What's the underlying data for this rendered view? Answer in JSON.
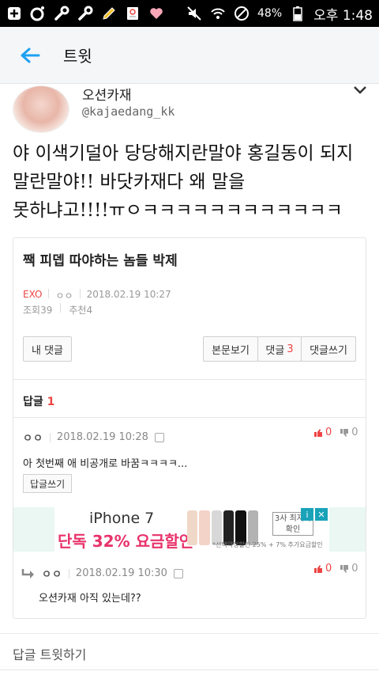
{
  "status_bar": {
    "battery": "48%",
    "time": "오후 1:48"
  },
  "app_bar": {
    "title": "트윗"
  },
  "tweet": {
    "author_name": "오션카재",
    "author_handle": "@kajaedang_kk",
    "text_line1": "야 이색기덜아 당당해지란말야 홍길동이 되지",
    "text_line2": "말란말야!! 바닷카재다 왜 말을",
    "text_line3": "못하냐고!!!!ㅠㅇㅋㅋㅋㅋㅋㅋㅋㅋㅋㅋㅋㅋ"
  },
  "card": {
    "post_title": "짹 피뎁 따야하는 놈들 박제",
    "category": "EXO",
    "post_author": "ㅇㅇ",
    "post_date": "2018.02.19 10:27",
    "views": "조회39",
    "likes": "추천4",
    "buttons": {
      "my_comments": "내 댓글",
      "view_post": "본문보기",
      "comments": "댓글",
      "comments_count": "3",
      "write_comment": "댓글쓰기"
    },
    "replies_label": "답글",
    "replies_count": "1",
    "comment1": {
      "author": "ㅇㅇ",
      "date": "2018.02.19 10:28",
      "up": "0",
      "down": "0",
      "text": "아 첫번째 애 비공개로 바꿈ㅋㅋㅋㅋ...",
      "reply_button": "답글쓰기"
    },
    "ad": {
      "brand": "iPhone 7",
      "promo": "단독 32% 요금할인",
      "box": "3사 최저가 확인",
      "fine": "*선택약정할인 25% + 7% 추가요금할인"
    },
    "comment2": {
      "author": "ㅇㅇ",
      "date": "2018.02.19 10:30",
      "up": "0",
      "down": "0",
      "text": "오션카재 아직 있는데??"
    }
  },
  "footer": {
    "reply_tweet": "답글 트윗하기"
  }
}
